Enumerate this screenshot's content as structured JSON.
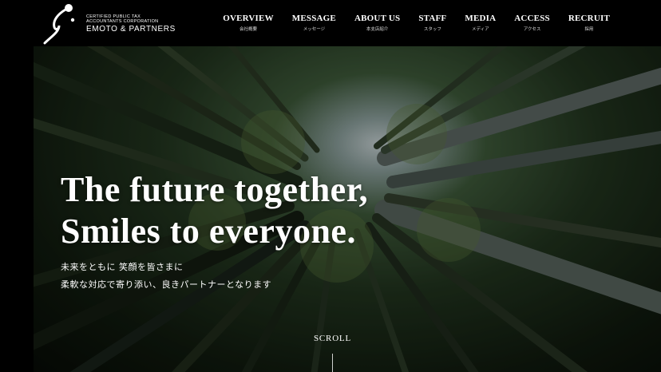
{
  "header": {
    "logo": {
      "line1": "CERTIFIED PUBLIC TAX",
      "line2": "ACCOUNTANTS CORPORATION",
      "line3": "EMOTO & PARTNERS"
    },
    "nav": [
      {
        "en": "OVERVIEW",
        "ja": "会社概要"
      },
      {
        "en": "MESSAGE",
        "ja": "メッセージ"
      },
      {
        "en": "ABOUT US",
        "ja": "本支店紹介"
      },
      {
        "en": "STAFF",
        "ja": "スタッフ"
      },
      {
        "en": "MEDIA",
        "ja": "メディア"
      },
      {
        "en": "ACCESS",
        "ja": "アクセス"
      },
      {
        "en": "RECRUIT",
        "ja": "採用"
      }
    ]
  },
  "hero": {
    "headline_line1": "The future together,",
    "headline_line2": "Smiles to everyone.",
    "sub_line1": "未来をともに 笑顔を皆さまに",
    "sub_line2": "柔軟な対応で寄り添い、良きパートナーとなります",
    "scroll_label": "SCROLL"
  }
}
